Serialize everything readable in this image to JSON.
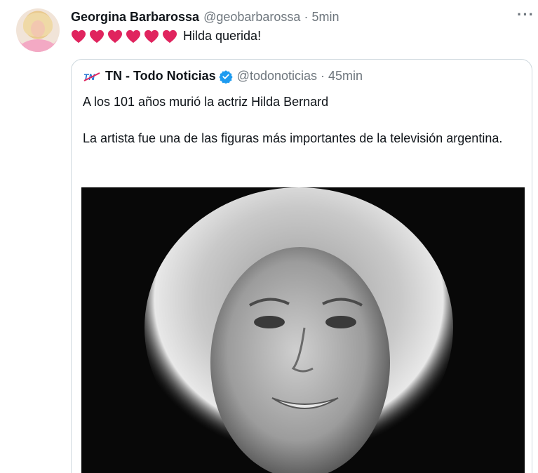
{
  "tweet": {
    "author_name": "Georgina Barbarossa",
    "author_handle": "@geobarbarossa",
    "separator": "·",
    "time": "5min",
    "hearts_count": 6,
    "heart_color": "#e0245e",
    "text": "Hilda querida!",
    "more_icon": "···"
  },
  "quoted_tweet": {
    "author_name": "TN - Todo Noticias",
    "author_handle": "@todonoticias",
    "separator": "·",
    "time": "45min",
    "verified_color": "#1d9bf0",
    "line1": "A los 101 años murió la actriz Hilda Bernard",
    "paragraph": "La artista fue una de las figuras más importantes de la televisión argentina.",
    "logo_icon": "tn-logo-icon",
    "photo": "black-and-white-portrait"
  }
}
